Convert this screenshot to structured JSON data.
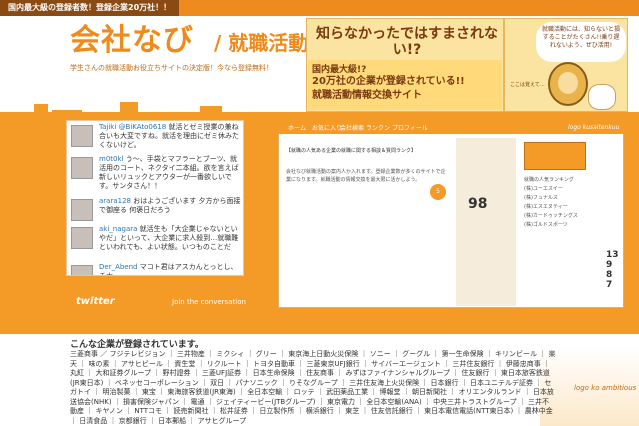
{
  "topbar": {
    "text": "国内最大級の登録者数！登録企業20万社！！"
  },
  "header": {
    "logo_main": "会社なび",
    "logo_sub": "/ 就職活動",
    "tagline_1": "学生さんの就職活動お役立ちサイトの決定版！今なら登録無料！",
    "banner_headline": "知らなかったではすまされない!?",
    "banner_line1": "国内最大級!?",
    "banner_line2": "20万社の企業が登録されている!!",
    "banner_line3": "就職活動情報交換サイト",
    "speech": "就職活動には、知らないと損することがたくさん!!乗り遅れないよう、ぜひ活用!",
    "side_note": "ここは覚えて…"
  },
  "twitter": {
    "tweets": [
      {
        "user": "Tajiki @BiKAto0618",
        "text": "就活とゼミ授業の兼ね合いも大変ですね。就活を理由にゼミ休みたくないけど。"
      },
      {
        "user": "m0t0kl",
        "text": "う〜、手袋とマフラーとブーツ、就活用のコート、ネクタイ二本組。欲を言えば新しいリュックとアウターが一番欲しいです。サンタさん！！"
      },
      {
        "user": "arara128",
        "text": "おはようございます 夕方から面接で御座る 何褒日だろう"
      },
      {
        "user": "aki_nagara",
        "text": "就活生も「大企業じゃないといやだ」といって、大企業に求人殺到…就職難といわれても、よい状態。いつものことだ"
      },
      {
        "user": "Der_Abend",
        "text": "マコト君はアスカんとっとし、チナ"
      }
    ],
    "logo": "twitter",
    "join": "Join the conversation"
  },
  "preview": {
    "nav": [
      "ホーム",
      "お気に入り",
      "会社検索",
      "ランクン",
      "プロフィール"
    ],
    "logo": "logo kusaitenkuu",
    "post_title": "【就職の人気ある企業の就職に関する相談＆質問ランク】",
    "post_body": "会社なび就職活動の案内人か入れます。登録企業数が多くのサイトで企業になります。就職活動の情報交換を最大限に活かしよう。",
    "badge": "5",
    "stat": "98",
    "right_title": "就職の人気ランキング",
    "right_list": [
      "(株)ユーエスイー",
      "(株)フュナルス",
      "(株)エスエヌティー",
      "(株)カードゥッチングス",
      "(株)ゴルドスポーツ"
    ],
    "right_nums": [
      "13",
      "9",
      "8",
      "7"
    ]
  },
  "bottom": {
    "title": "こんな企業が登録されています。",
    "companies": "三菱商事 ／ フジテレビジョン ｜ 三井物産 ｜ ミクシィ ｜ グリー ｜ 東京海上日動火災保険 ｜ ソニー ｜ グーグル ｜ 第一生命保険 ｜ キリンビール ｜ 楽天 ｜ 味の素 ｜ アサヒビール ｜ 資生堂 ｜ リクルート ｜ トヨタ自動車 ｜ 三菱東京UFJ銀行 ｜ サイバーエージェント ｜ 三井住友銀行 ｜ 伊藤忠商事 ｜ 丸紅 ｜ 大和証券グループ ｜ 野村證券 ｜ 三菱UFJ証券 ｜ 日本生命保険 ｜ 住友商事 ｜ みずほファイナンシャルグループ ｜ 住友銀行 ｜ 東日本旅客鉄道(JR東日本) ｜ ベネッセコーポレーション ｜ 双日 ｜ パナソニック ｜ りそなグループ ｜ 三井住友海上火災保険 ｜ 日本銀行 ｜ 日本ユニテルデ証券 ｜ セガトイ ｜ 明治製菓 ｜ 東宝 ｜ 東海旅客鉄道(JR東海) ｜ 全日本空輸 ｜ ロッテ ｜ 武田薬品工業 ｜ 博報堂 ｜ 朝日新聞社 ｜ オリエンタルランド ｜ 日本放送協会(NHK) ｜ 損害保険ジャパン ｜ 電通 ｜ ジェイティービー(JTBグループ) ｜ 東京電力 ｜ 全日本空輸(ANA) ｜ 中央三井トラストグループ ｜ 三井不動産 ｜ キヤノン ｜ NTTコモ ｜ 読売新聞社 ｜ 松井証券 ｜ 日立製作所 ｜ 横浜銀行 ｜ 東芝 ｜ 住友信託銀行 ｜ 東日本電信電話(NTT東日本) ｜ 農林中金 ｜ 日清食品 ｜ 京都銀行 ｜ 日本郵船 ｜ アサヒグループ",
    "logo": "logo ko ambitious"
  }
}
